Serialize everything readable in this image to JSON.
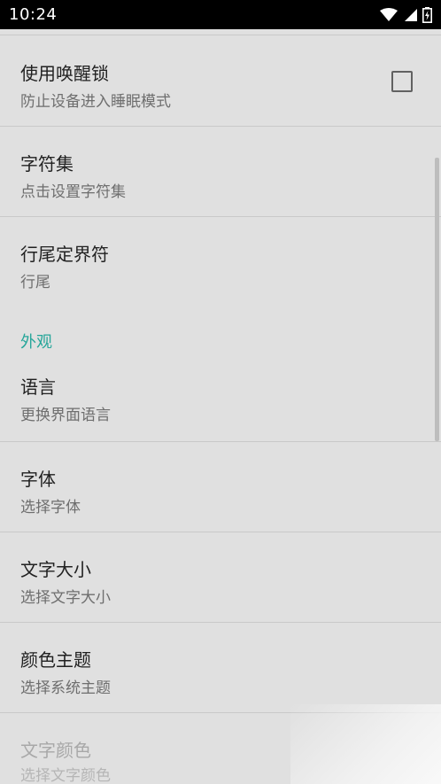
{
  "status_bar": {
    "time": "10:24",
    "icons": [
      "wifi-icon",
      "cell-signal-icon",
      "battery-charging-icon"
    ]
  },
  "colors": {
    "background": "#e0e0e0",
    "accent": "#26a69a",
    "status_bar": "#000000"
  },
  "settings": {
    "wake_lock": {
      "title": "使用唤醒锁",
      "summary": "防止设备进入睡眠模式",
      "checked": false
    },
    "charset": {
      "title": "字符集",
      "summary": "点击设置字符集"
    },
    "line_ending": {
      "title": "行尾定界符",
      "summary": "行尾"
    },
    "appearance_header": "外观",
    "language": {
      "title": "语言",
      "summary": "更换界面语言"
    },
    "font": {
      "title": "字体",
      "summary": "选择字体"
    },
    "text_size": {
      "title": "文字大小",
      "summary": "选择文字大小"
    },
    "color_theme": {
      "title": "颜色主题",
      "summary": "选择系统主题"
    },
    "text_color": {
      "title": "文字颜色",
      "summary": "选择文字颜色"
    }
  }
}
